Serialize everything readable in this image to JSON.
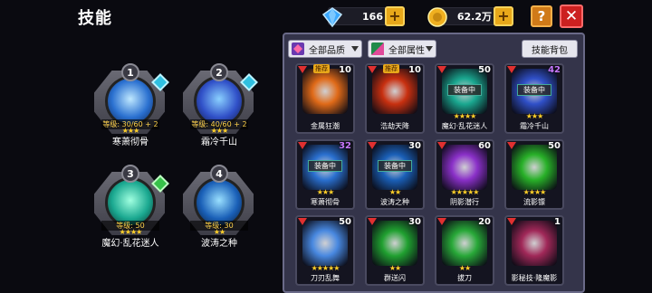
{
  "title": "技能",
  "resources": {
    "diamonds": "166",
    "coins": "62.2万"
  },
  "buttons": {
    "help": "?",
    "close": "✕",
    "plus": "+"
  },
  "slots": [
    {
      "num": "1",
      "level": "等级: 30/60 + 2",
      "stars": "★★★",
      "name": "寒萧彻骨"
    },
    {
      "num": "2",
      "level": "等级: 40/60 + 2",
      "stars": "★★★",
      "name": "霜冷千山"
    },
    {
      "num": "3",
      "level": "等级: 50",
      "stars": "★★★★",
      "name": "魔幻·乱花迷人"
    },
    {
      "num": "4",
      "level": "等级: 30",
      "stars": "★★",
      "name": "波涛之种"
    }
  ],
  "panel": {
    "filter_quality": "全部品质",
    "filter_attr": "全部属性",
    "bag_button": "技能背包"
  },
  "cards": [
    {
      "count": "10",
      "rec": "推荐",
      "equip": "",
      "stars": "",
      "name": "金属狂潮",
      "color": "#e06a18"
    },
    {
      "count": "10",
      "rec": "推荐",
      "equip": "",
      "stars": "",
      "name": "浩劫天降",
      "color": "#c83010"
    },
    {
      "count": "50",
      "rec": "",
      "equip": "装备中",
      "stars": "★★★★",
      "name": "魔幻·乱花迷人",
      "color": "#1aa890"
    },
    {
      "count": "42",
      "rec": "",
      "equip": "装备中",
      "stars": "★★★",
      "name": "霜冷千山",
      "color": "#3050c8"
    },
    {
      "count": "32",
      "rec": "",
      "equip": "装备中",
      "stars": "★★★",
      "name": "寒萧彻骨",
      "color": "#2a70d0"
    },
    {
      "count": "30",
      "rec": "",
      "equip": "装备中",
      "stars": "★★",
      "name": "波涛之种",
      "color": "#1a60b8"
    },
    {
      "count": "60",
      "rec": "",
      "equip": "",
      "stars": "★★★★★",
      "name": "阴影潜行",
      "color": "#8a30c8"
    },
    {
      "count": "50",
      "rec": "",
      "equip": "",
      "stars": "★★★★",
      "name": "流影镖",
      "color": "#28b028"
    },
    {
      "count": "50",
      "rec": "",
      "equip": "",
      "stars": "★★★★★",
      "name": "刀刃乱舞",
      "color": "#4888e0"
    },
    {
      "count": "30",
      "rec": "",
      "equip": "",
      "stars": "★★",
      "name": "群送闪",
      "color": "#20a030"
    },
    {
      "count": "20",
      "rec": "",
      "equip": "",
      "stars": "★★",
      "name": "拔刀",
      "color": "#28a838"
    },
    {
      "count": "1",
      "rec": "",
      "equip": "",
      "stars": "",
      "name": "影秘技·隆魔影",
      "color": "#a02858"
    }
  ]
}
